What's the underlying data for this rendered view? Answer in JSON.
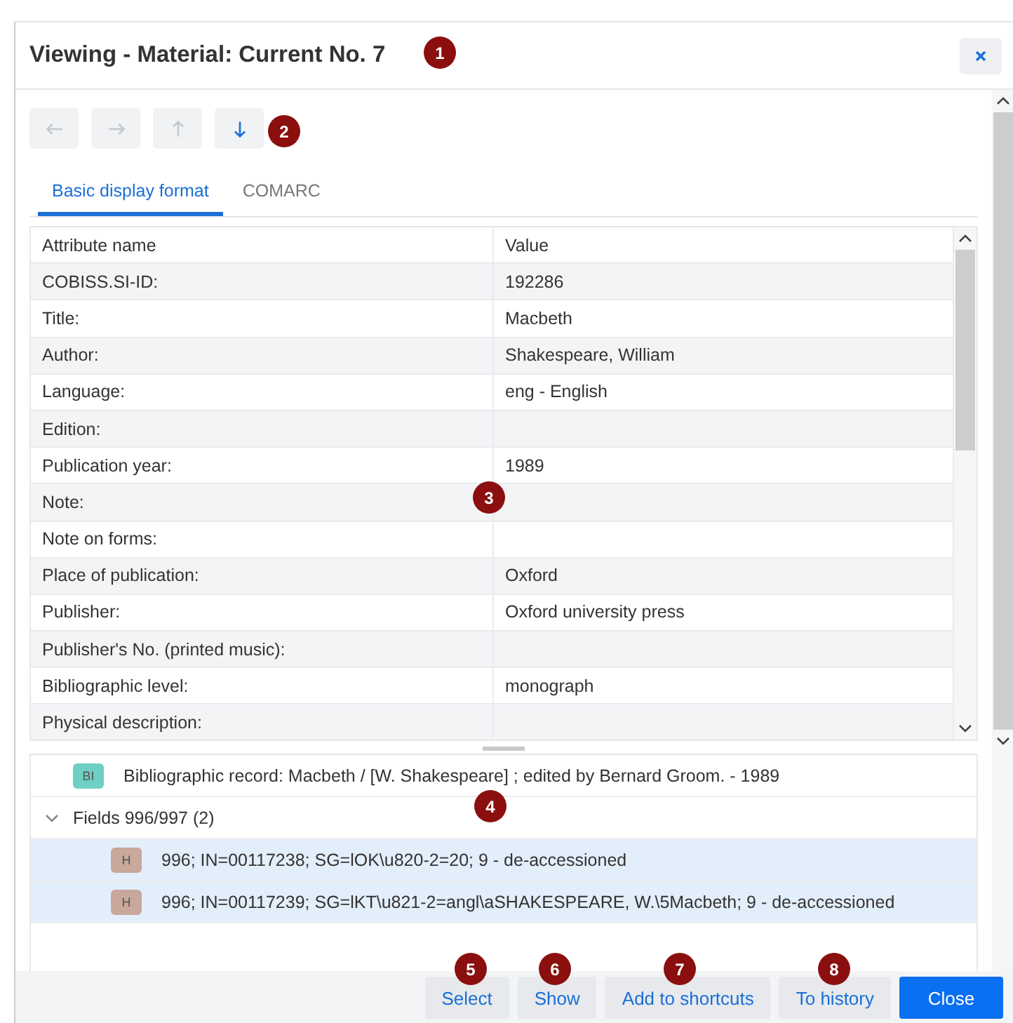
{
  "window": {
    "title": "Viewing - Material: Current No. 7"
  },
  "nav_buttons": [
    {
      "kind": "left",
      "disabled": true
    },
    {
      "kind": "right",
      "disabled": true
    },
    {
      "kind": "up",
      "disabled": true
    },
    {
      "kind": "down",
      "disabled": false
    }
  ],
  "tabs": [
    {
      "label": "Basic display format",
      "selected": true
    },
    {
      "label": "COMARC",
      "selected": false
    }
  ],
  "table": {
    "columns": [
      "Attribute name",
      "Value"
    ],
    "rows": [
      {
        "name": "COBISS.SI-ID:",
        "value": "192286"
      },
      {
        "name": "Title:",
        "value": "Macbeth"
      },
      {
        "name": "Author:",
        "value": "Shakespeare, William"
      },
      {
        "name": "Language:",
        "value": "eng - English"
      },
      {
        "name": "Edition:"
      },
      {
        "name": "Publication year:",
        "value": "1989"
      },
      {
        "name": "Note:"
      },
      {
        "name": "Note on forms:"
      },
      {
        "name": "Place of publication:",
        "value": "Oxford"
      },
      {
        "name": "Publisher:",
        "value": "Oxford university press"
      },
      {
        "name": "Publisher's No. (printed music):"
      },
      {
        "name": "Bibliographic level:",
        "value": "monograph"
      },
      {
        "name": "Physical description:"
      }
    ]
  },
  "record": {
    "badge": "BI",
    "color": "#6fcfc4",
    "text": "Bibliographic record: Macbeth / [W. Shakespeare] ; edited by Bernard Groom. - 1989"
  },
  "fields_group": {
    "label": "Fields 996/997 (2)",
    "expanded": true,
    "children": [
      {
        "badge": "H",
        "color": "#c9a89c",
        "text": "996; IN=00117238; SG=lOK\\u820-2=20; 9 - de-accessioned",
        "selected": true
      },
      {
        "badge": "H",
        "color": "#c9a89c",
        "text": "996; IN=00117239; SG=lKT\\u821-2=angl\\aSHAKESPEARE, W.\\5Macbeth; 9 - de-accessioned",
        "selected": true
      }
    ]
  },
  "buttons": [
    {
      "label": "Select",
      "kind": "secondary"
    },
    {
      "label": "Show",
      "kind": "secondary"
    },
    {
      "label": "Add to shortcuts",
      "kind": "secondary"
    },
    {
      "label": "To history",
      "kind": "secondary"
    },
    {
      "label": "Close",
      "kind": "primary"
    }
  ],
  "callouts": [
    "1",
    "2",
    "3",
    "4",
    "5",
    "6",
    "7",
    "8"
  ]
}
